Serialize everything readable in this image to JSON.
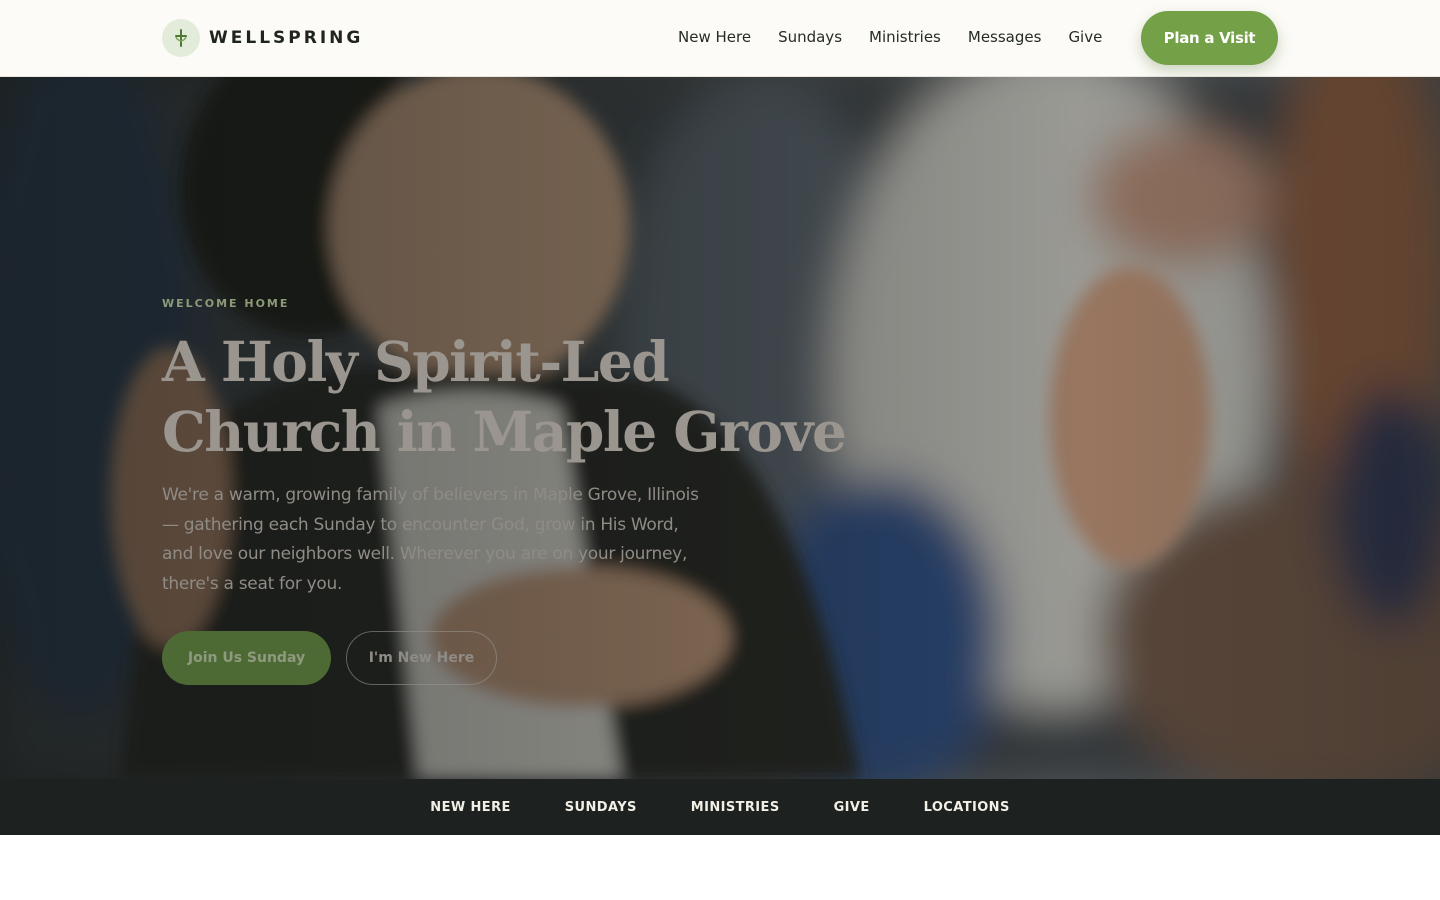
{
  "brand": {
    "name": "WELLSPRING",
    "logo_icon": "cross-sprout-icon",
    "accent": "#74a047"
  },
  "nav": {
    "items": [
      "New Here",
      "Sundays",
      "Ministries",
      "Messages",
      "Give"
    ],
    "cta": "Plan a Visit"
  },
  "hero": {
    "eyebrow": "WELCOME HOME",
    "title_line1": "A Holy Spirit-Led",
    "title_line2": "Church in Maple Grove",
    "body": "We're a warm, growing family of believers in Maple Grove, Illinois — gathering each Sunday to encounter God, grow in His Word, and love our neighbors well. Wherever you are on your journey, there's a seat for you.",
    "primary_button": "Join Us Sunday",
    "secondary_button": "I'm New Here",
    "image": "worship-photo"
  },
  "subnav": {
    "items": [
      "NEW HERE",
      "SUNDAYS",
      "MINISTRIES",
      "GIVE",
      "LOCATIONS"
    ],
    "background": "#1d211f"
  }
}
